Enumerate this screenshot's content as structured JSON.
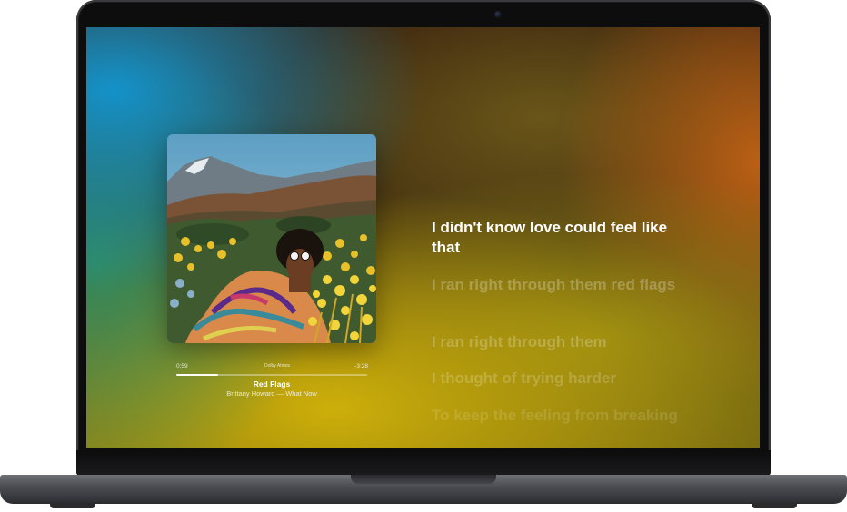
{
  "now_playing": {
    "title": "Red Flags",
    "artist_album": "Brittany Howard — What Now",
    "elapsed": "0:59",
    "remaining": "-3:28",
    "audio_badge": "Dolby Atmos",
    "progress": 0.22
  },
  "lyrics": {
    "current": "I didn't know love could feel like that",
    "upcoming": [
      "I ran right through them red flags",
      "I ran right through them",
      "I thought of trying harder",
      "To keep the feeling from breaking"
    ]
  },
  "colors": {
    "lyric_active": "#ffffff",
    "background_primary": "#cdaf0a",
    "background_accent": "#1296d2"
  }
}
